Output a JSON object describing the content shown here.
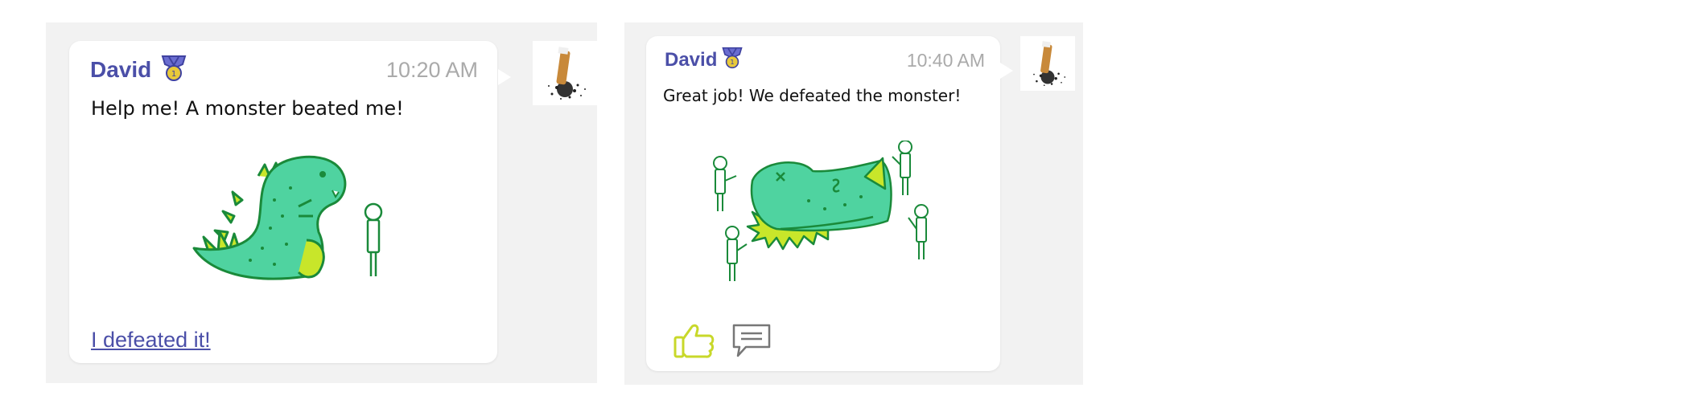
{
  "messages": [
    {
      "sender": "David",
      "time": "10:20 AM",
      "text": "Help me! A monster beated me!",
      "link_text": "I defeated it!"
    },
    {
      "sender": "David",
      "time": "10:40 AM",
      "text": "Great job! We defeated the monster!"
    }
  ],
  "colors": {
    "sender": "#4b4fa8",
    "time": "#aaaaaa",
    "panel_bg": "#f2f2f2",
    "monster_fill": "#4fd3a0",
    "monster_stroke": "#1a8a3a",
    "spikes": "#c8e62a",
    "like_icon": "#c8d82a"
  },
  "icons": [
    "medal-icon",
    "thumbs-up-icon",
    "comment-icon",
    "cigarette-avatar"
  ]
}
